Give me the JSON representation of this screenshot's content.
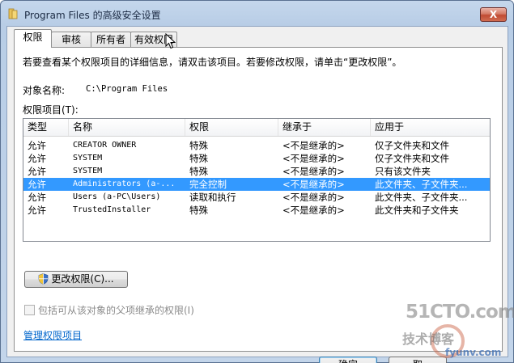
{
  "window": {
    "title": "Program Files 的高级安全设置",
    "close_label": "X"
  },
  "tabs": [
    "权限",
    "审核",
    "所有者",
    "有效权限"
  ],
  "intro_text": "若要查看某个权限项目的详细信息，请双击该项目。若要修改权限，请单击“更改权限”。",
  "object": {
    "label": "对象名称:",
    "value": "C:\\Program Files"
  },
  "permissions": {
    "label": "权限项目(T):",
    "columns": [
      "类型",
      "名称",
      "权限",
      "继承于",
      "应用于"
    ],
    "rows": [
      {
        "type": "允许",
        "name": "CREATOR OWNER",
        "permission": "特殊",
        "inherited": "<不是继承的>",
        "applies": "仅子文件夹和文件",
        "selected": false
      },
      {
        "type": "允许",
        "name": "SYSTEM",
        "permission": "特殊",
        "inherited": "<不是继承的>",
        "applies": "仅子文件夹和文件",
        "selected": false
      },
      {
        "type": "允许",
        "name": "SYSTEM",
        "permission": "特殊",
        "inherited": "<不是继承的>",
        "applies": "只有该文件夹",
        "selected": false
      },
      {
        "type": "允许",
        "name": "Administrators (a-...",
        "permission": "完全控制",
        "inherited": "<不是继承的>",
        "applies": "此文件夹、子文件夹...",
        "selected": true
      },
      {
        "type": "允许",
        "name": "Users (a-PC\\Users)",
        "permission": "读取和执行",
        "inherited": "<不是继承的>",
        "applies": "此文件夹、子文件夹...",
        "selected": false
      },
      {
        "type": "允许",
        "name": "TrustedInstaller",
        "permission": "特殊",
        "inherited": "<不是继承的>",
        "applies": "此文件夹和子文件夹",
        "selected": false
      }
    ]
  },
  "change_button": {
    "label": "更改权限(C)...",
    "icon": "uac-shield-icon"
  },
  "inherit_checkbox": {
    "label": "包括可从该对象的父项继承的权限(I)",
    "checked": false,
    "enabled": false
  },
  "manage_link": "管理权限项目",
  "buttons": {
    "ok": "确定",
    "cancel": "取"
  },
  "watermark": {
    "line1": "51CTO.com",
    "line2": "技术博客",
    "line3": "fyunv.com"
  },
  "colors": {
    "selection": "#3399ff",
    "link": "#0066cc"
  }
}
